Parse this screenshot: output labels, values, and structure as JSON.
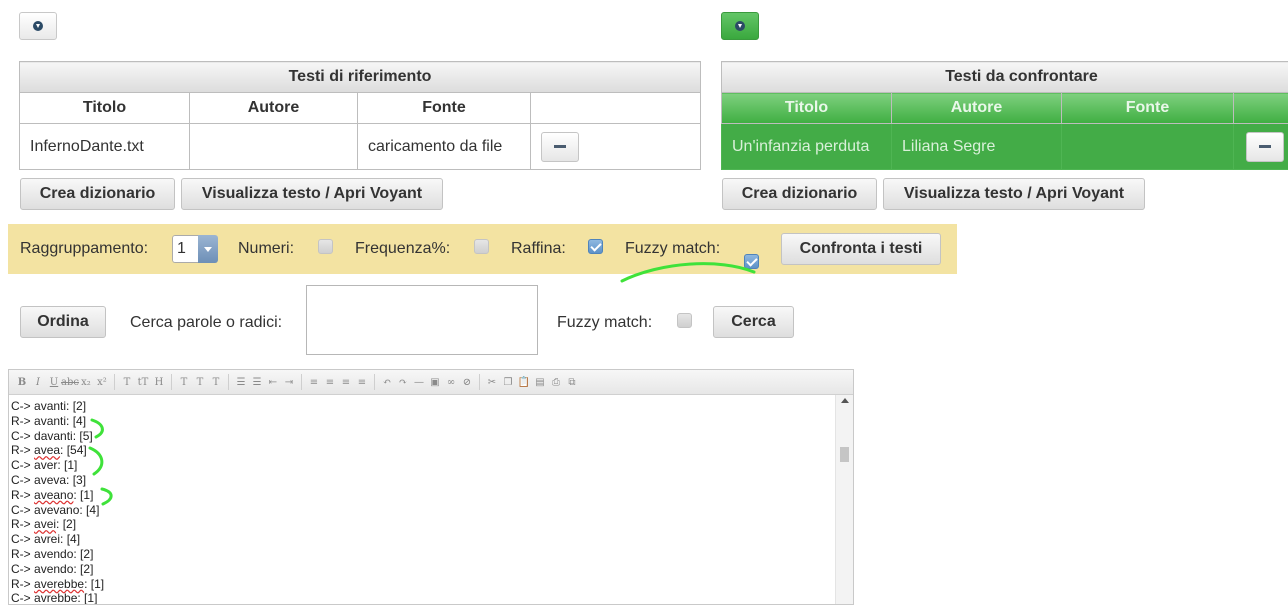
{
  "ref": {
    "caption": "Testi di riferimento",
    "headers": [
      "Titolo",
      "Autore",
      "Fonte"
    ],
    "row": {
      "titolo": "InfernoDante.txt",
      "autore": "",
      "fonte": "caricamento da file"
    }
  },
  "cmp": {
    "caption": "Testi da confrontare",
    "headers": [
      "Titolo",
      "Autore",
      "Fonte"
    ],
    "row": {
      "titolo": "Un'infanzia perduta",
      "autore": "Liliana Segre",
      "fonte": ""
    }
  },
  "buttons": {
    "crea_dizionario": "Crea dizionario",
    "visualizza": "Visualizza testo / Apri Voyant",
    "confronta": "Confronta i testi",
    "ordina": "Ordina",
    "cerca": "Cerca"
  },
  "options": {
    "raggruppamento_label": "Raggruppamento:",
    "raggruppamento_value": "1",
    "numeri_label": "Numeri:",
    "numeri_checked": false,
    "frequenza_label": "Frequenza%:",
    "frequenza_checked": false,
    "raffina_label": "Raffina:",
    "raffina_checked": true,
    "fuzzy_label": "Fuzzy match:",
    "fuzzy_checked": true
  },
  "search": {
    "label": "Cerca parole o radici:",
    "value": "",
    "fuzzy_label": "Fuzzy match:",
    "fuzzy_checked": false
  },
  "editor": {
    "lines": [
      {
        "prefix": "C-> ",
        "word": "avanti",
        "count": ": [2]",
        "underline": false
      },
      {
        "prefix": "R-> ",
        "word": "avanti",
        "count": ": [4]",
        "underline": false
      },
      {
        "prefix": "C-> ",
        "word": "davanti",
        "count": ": [5]",
        "underline": false
      },
      {
        "prefix": "R-> ",
        "word": "avea",
        "count": ": [54]",
        "underline": true
      },
      {
        "prefix": "C-> ",
        "word": "aver",
        "count": ": [1]",
        "underline": false
      },
      {
        "prefix": "C-> ",
        "word": "aveva",
        "count": ": [3]",
        "underline": false
      },
      {
        "prefix": "R-> ",
        "word": "aveano",
        "count": ": [1]",
        "underline": true
      },
      {
        "prefix": "C-> ",
        "word": "avevano",
        "count": ": [4]",
        "underline": false
      },
      {
        "prefix": "R-> ",
        "word": "avei",
        "count": ": [2]",
        "underline": true
      },
      {
        "prefix": "C-> ",
        "word": "avrei",
        "count": ": [4]",
        "underline": false
      },
      {
        "prefix": "R-> ",
        "word": "avendo",
        "count": ": [2]",
        "underline": false
      },
      {
        "prefix": "C-> ",
        "word": "avendo",
        "count": ": [2]",
        "underline": false
      },
      {
        "prefix": "R-> ",
        "word": "averebbe",
        "count": ": [1]",
        "underline": true
      },
      {
        "prefix": "C-> ",
        "word": "avrebbe",
        "count": ": [1]",
        "underline": false
      }
    ]
  },
  "colors": {
    "green_panel": "#43ac47",
    "yellow_bar": "#f3e3a2",
    "highlight_stroke": "#3fe23a"
  }
}
